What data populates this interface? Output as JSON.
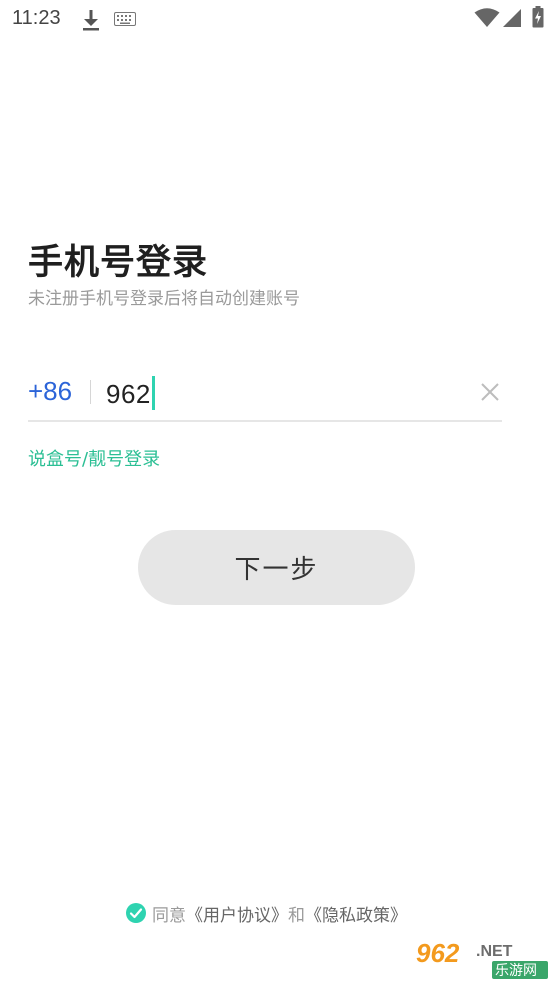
{
  "status_bar": {
    "time": "11:23"
  },
  "login": {
    "title": "手机号登录",
    "subtitle": "未注册手机号登录后将自动创建账号",
    "country_code": "+86",
    "phone_value": "962",
    "alt_login": "说盒号/靓号登录",
    "next_button": "下一步"
  },
  "agreement": {
    "prefix": "同意",
    "user_agreement": "《用户协议》",
    "connector": "和",
    "privacy_policy": "《隐私政策》",
    "checked": true
  },
  "watermark": {
    "brand_number": "962",
    "brand_suffix": ".NET",
    "brand_name": "乐游网"
  },
  "colors": {
    "accent": "#2bbf94",
    "country_code": "#2c64d8",
    "caret": "#2ed3b0",
    "button_bg": "#e6e6e6"
  },
  "icons": {
    "status": [
      "download-icon",
      "keyboard-icon",
      "wifi-icon",
      "signal-icon",
      "battery-charging-icon"
    ],
    "clear": "close-icon",
    "agree": "check-circle-icon"
  }
}
